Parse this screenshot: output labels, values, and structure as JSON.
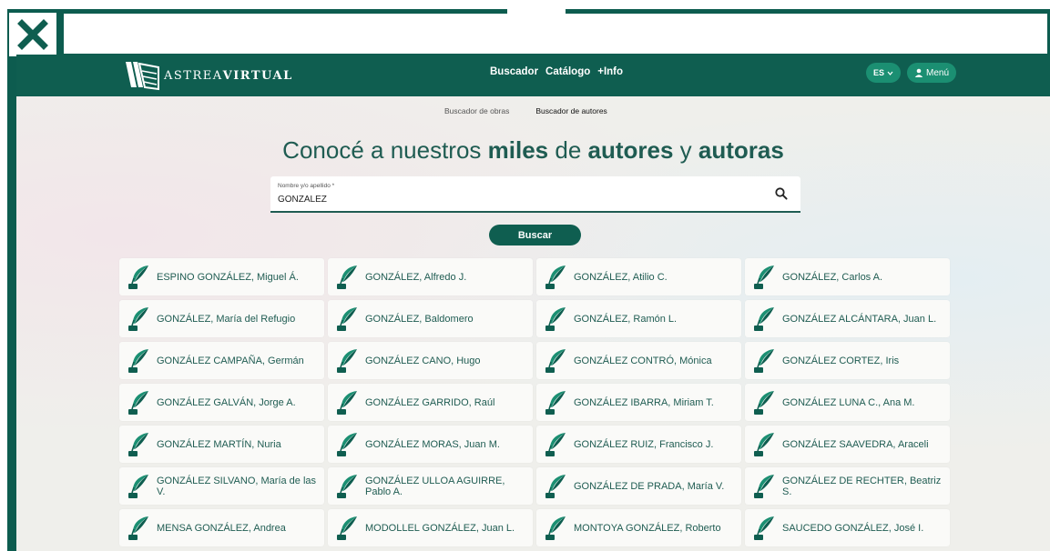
{
  "logo": {
    "prefix": "ASTREA",
    "suffix": "VIRTUAL"
  },
  "nav": {
    "links": [
      "Buscador",
      "Catálogo",
      "+Info"
    ],
    "lang": "ES",
    "menu": "Menú"
  },
  "subtabs": [
    "Buscador de obras",
    "Buscador de autores"
  ],
  "headline": {
    "p1": "Conocé a nuestros ",
    "b1": "miles",
    "p2": " de ",
    "b2": "autores",
    "p3": " y ",
    "b3": "autoras"
  },
  "search": {
    "label": "Nombre y/o apellido *",
    "value": "GONZALEZ"
  },
  "buscar_label": "Buscar",
  "authors": [
    "ESPINO GONZÁLEZ, Miguel Á.",
    "GONZÁLEZ, Alfredo J.",
    "GONZÁLEZ, Atilio C.",
    "GONZÁLEZ, Carlos A.",
    "GONZÁLEZ, María del Refugio",
    "GONZÁLEZ, Baldomero",
    "GONZÁLEZ, Ramón L.",
    "GONZÁLEZ ALCÁNTARA, Juan L.",
    "GONZÁLEZ CAMPAÑA, Germán",
    "GONZÁLEZ CANO, Hugo",
    "GONZÁLEZ CONTRÓ, Mónica",
    "GONZÁLEZ CORTEZ, Iris",
    "GONZÁLEZ GALVÁN, Jorge A.",
    "GONZÁLEZ GARRIDO, Raúl",
    "GONZÁLEZ IBARRA, Miriam T.",
    "GONZÁLEZ LUNA C., Ana M.",
    "GONZÁLEZ MARTÍN, Nuria",
    "GONZÁLEZ MORAS, Juan M.",
    "GONZÁLEZ RUIZ, Francisco J.",
    "GONZÁLEZ SAAVEDRA, Araceli",
    "GONZÁLEZ SILVANO, María de las V.",
    "GONZÁLEZ ULLOA AGUIRRE, Pablo A.",
    "GONZÁLEZ DE PRADA, María V.",
    "GONZÁLEZ DE RECHTER, Beatriz S.",
    "MENSA GONZÁLEZ, Andrea",
    "MODOLLEL GONZÁLEZ, Juan L.",
    "MONTOYA GONZÁLEZ, Roberto",
    "SAUCEDO GONZÁLEZ, José I."
  ],
  "colors": {
    "brand": "#0f5e50",
    "accent": "#1b8f72",
    "text": "#1f5c52"
  }
}
